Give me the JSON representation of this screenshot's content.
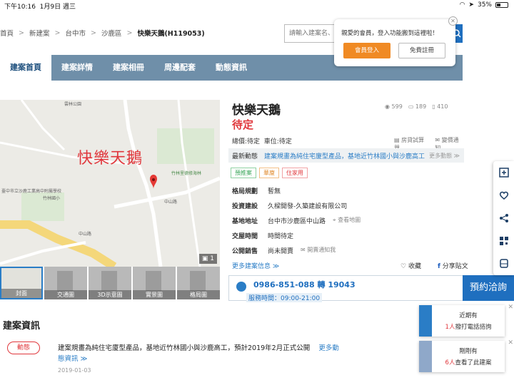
{
  "status_bar": {
    "time": "下午10:16",
    "date": "1月9日 週三",
    "battery": "35%"
  },
  "breadcrumb": [
    "首頁",
    "新建案",
    "台中市",
    "沙鹿區"
  ],
  "breadcrumb_current": "快樂天鵝(H119053)",
  "search": {
    "placeholder": "請輸入建案名、地區"
  },
  "popup": {
    "message": "親愛的會員，登入功能搬到這裡啦！",
    "login": "會員登入",
    "register": "免費註冊"
  },
  "nav_tabs": [
    "建案首頁",
    "建案詳情",
    "建案相冊",
    "周邊配套",
    "動態資訊"
  ],
  "map": {
    "title": "快樂天鵝",
    "labels": [
      "雲林公園",
      "竹林里德修海林",
      "中山路",
      "竹林國小",
      "臺中市立沙鹿工業高中附屬學校",
      "中山路"
    ],
    "photo_count": "1"
  },
  "thumbs": [
    "封面",
    "交通圖",
    "3D示意圖",
    "實景圖",
    "格局圖"
  ],
  "project": {
    "name": "快樂天鵝",
    "views": "599",
    "comments": "189",
    "follows": "410",
    "price_status": "待定",
    "total_price_label": "總價:待定",
    "parking_label": "車位:待定",
    "tools": [
      "房貸試算器",
      "變價通知"
    ],
    "latest_news_label": "最新動態",
    "latest_news": "建案規畫為純住宅廈型產品，基地近竹林國小與沙鹿高工",
    "latest_more": "更多動態 ≫",
    "tags": [
      "預推案",
      "華廈",
      "住家用"
    ],
    "details": [
      {
        "key": "格局規劃",
        "value": "暫無",
        "extra": ""
      },
      {
        "key": "投資建設",
        "value": "久樑開發-久築建設有限公司",
        "extra": ""
      },
      {
        "key": "基地地址",
        "value": "台中市沙鹿區中山路",
        "extra": "查看地圖"
      },
      {
        "key": "交屋時間",
        "value": "時間待定",
        "extra": ""
      },
      {
        "key": "公開銷售",
        "value": "尚未開賣",
        "extra": "開賣通知我"
      }
    ],
    "more_info": "更多建案信息 ≫",
    "favorite": "收藏",
    "share": "分享貼文",
    "line": "分"
  },
  "contact": {
    "phone": "0986-851-088 轉 19043",
    "hours": "服務時間：09:00-21:00",
    "reserve": "預約洽詢"
  },
  "section": {
    "title": "建案資訊",
    "pill": "動態",
    "text": "建案規畫為純住宅廈型產品，基地近竹林國小與沙鹿高工，預計2019年2月正式公開",
    "more": "更多動態資訊 ≫",
    "date": "2019-01-03"
  },
  "notices": [
    {
      "title": "近期有",
      "count": "1人",
      "text": "撥打電話諮詢"
    },
    {
      "title": "剛剛有",
      "count": "6人",
      "text": "查看了此建案"
    }
  ]
}
